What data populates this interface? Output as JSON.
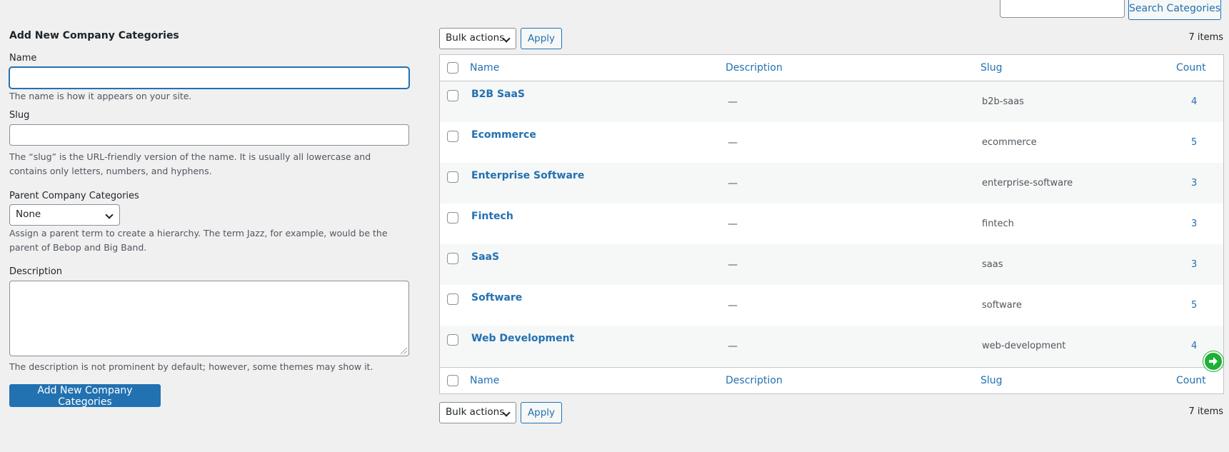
{
  "search": {
    "value": "",
    "button_label": "Search Categories"
  },
  "form": {
    "title": "Add New Company Categories",
    "name_label": "Name",
    "name_value": "",
    "name_hint": "The name is how it appears on your site.",
    "slug_label": "Slug",
    "slug_value": "",
    "slug_hint": "The “slug” is the URL-friendly version of the name. It is usually all lowercase and contains only letters, numbers, and hyphens.",
    "parent_label": "Parent Company Categories",
    "parent_selected": "None",
    "parent_hint": "Assign a parent term to create a hierarchy. The term Jazz, for example, would be the parent of Bebop and Big Band.",
    "description_label": "Description",
    "description_hint": "The description is not prominent by default; however, some themes may show it.",
    "submit_label": "Add New Company Categories"
  },
  "table_nav": {
    "bulk_selected": "Bulk actions",
    "apply_label": "Apply",
    "items_count": "7 items"
  },
  "table": {
    "columns": {
      "name": "Name",
      "description": "Description",
      "slug": "Slug",
      "count": "Count"
    },
    "rows": [
      {
        "name": "B2B SaaS",
        "description": "—",
        "slug": "b2b-saas",
        "count": "4"
      },
      {
        "name": "Ecommerce",
        "description": "—",
        "slug": "ecommerce",
        "count": "5"
      },
      {
        "name": "Enterprise Software",
        "description": "—",
        "slug": "enterprise-software",
        "count": "3"
      },
      {
        "name": "Fintech",
        "description": "—",
        "slug": "fintech",
        "count": "3"
      },
      {
        "name": "SaaS",
        "description": "—",
        "slug": "saas",
        "count": "3"
      },
      {
        "name": "Software",
        "description": "—",
        "slug": "software",
        "count": "5"
      },
      {
        "name": "Web Development",
        "description": "—",
        "slug": "web-development",
        "count": "4"
      }
    ]
  },
  "icons": {
    "go_icon": "arrow-right-circle-icon",
    "go_icon_color": "#1fb036",
    "accent_color": "#2271b1"
  }
}
